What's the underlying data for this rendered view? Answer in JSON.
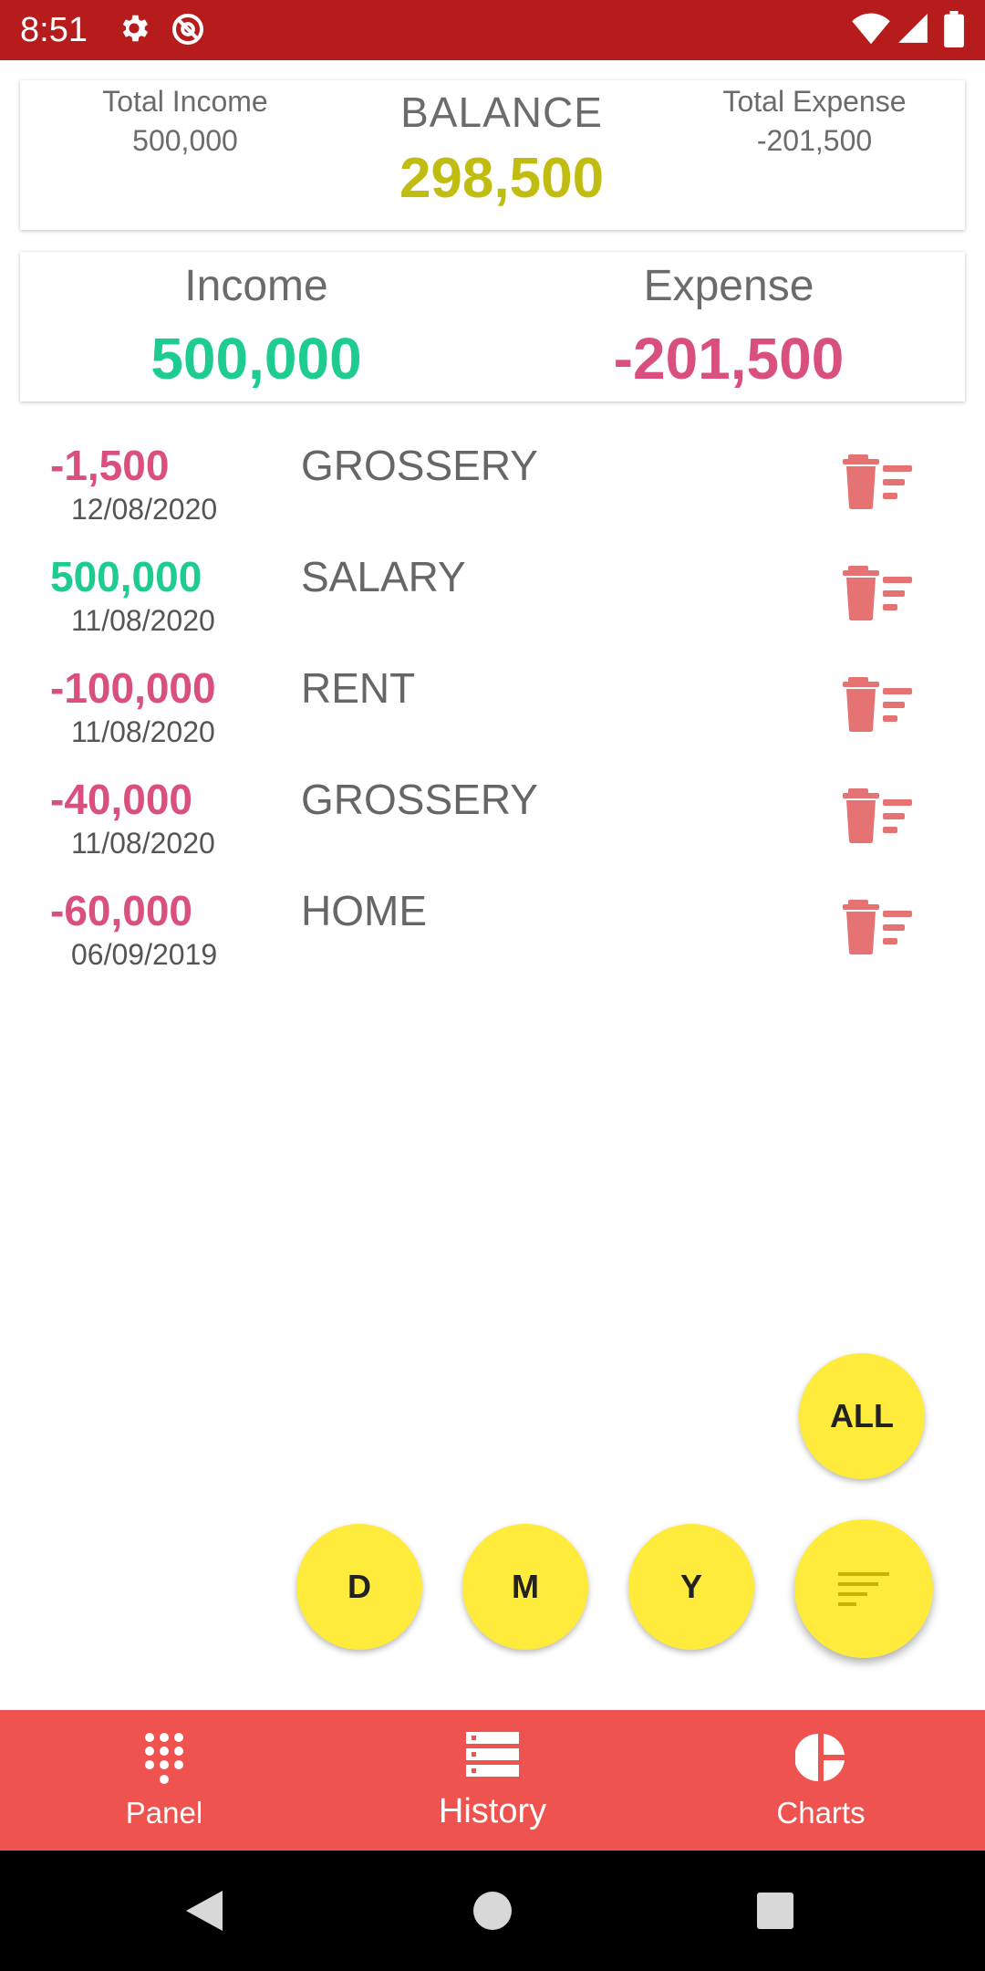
{
  "status_bar": {
    "time": "8:51"
  },
  "summary": {
    "total_income_label": "Total Income",
    "total_income_value": "500,000",
    "balance_label": "BALANCE",
    "balance_value": "298,500",
    "total_expense_label": "Total Expense",
    "total_expense_value": "-201,500"
  },
  "totals": {
    "income_label": "Income",
    "income_value": "500,000",
    "expense_label": "Expense",
    "expense_value": "-201,500"
  },
  "transactions": [
    {
      "amount": "-1,500",
      "date": "12/08/2020",
      "category": "GROSSERY"
    },
    {
      "amount": "500,000",
      "date": "11/08/2020",
      "category": "SALARY"
    },
    {
      "amount": "-100,000",
      "date": "11/08/2020",
      "category": "RENT"
    },
    {
      "amount": "-40,000",
      "date": "11/08/2020",
      "category": "GROSSERY"
    },
    {
      "amount": "-60,000",
      "date": "06/09/2019",
      "category": "HOME"
    }
  ],
  "filters": {
    "all": "ALL",
    "day": "D",
    "month": "M",
    "year": "Y"
  },
  "nav": {
    "panel": "Panel",
    "history": "History",
    "charts": "Charts"
  },
  "colors": {
    "status_bar": "#b71c1c",
    "bottom_nav": "#ef5350",
    "income": "#1fcc8f",
    "expense": "#d94f7f",
    "balance": "#c0bd10",
    "fab": "#ffeb3b",
    "delete_icon": "#e57373"
  }
}
